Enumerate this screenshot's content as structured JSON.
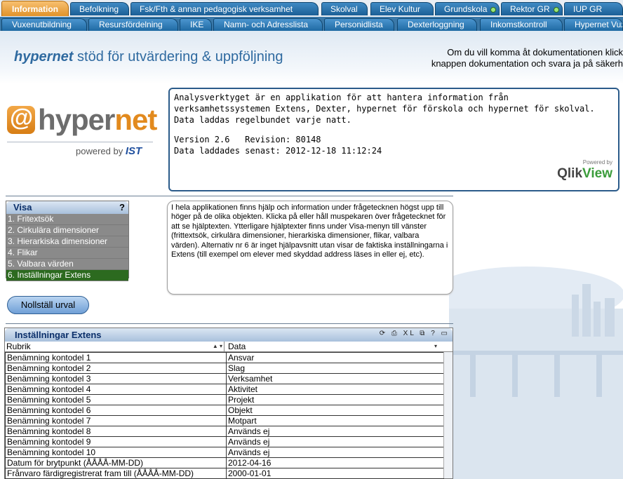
{
  "tabs_row1": [
    {
      "label": "Information",
      "active": true
    },
    {
      "label": "Befolkning"
    },
    {
      "label": "Fsk/Fth & annan pedagogisk verksamhet"
    },
    {
      "label": "Skolval"
    },
    {
      "label": "Elev Kultur"
    },
    {
      "label": "Grundskola",
      "dot": true
    },
    {
      "label": "Rektor GR",
      "dot": true
    },
    {
      "label": "IUP GR"
    }
  ],
  "tabs_row2": [
    {
      "label": "Vuxenutbildning"
    },
    {
      "label": "Resursfördelning"
    },
    {
      "label": "IKE"
    },
    {
      "label": "Namn- och Adresslista"
    },
    {
      "label": "Personidlista"
    },
    {
      "label": "Dexterloggning"
    },
    {
      "label": "Inkomstkontroll"
    },
    {
      "label": "Hypernet Vux"
    }
  ],
  "header": {
    "brand": "hypernet",
    "title_rest": " stöd för utvärdering & uppföljning",
    "note_line1": "Om du vill komma åt dokumentationen klick",
    "note_line2": "knappen dokumentation och svara ja på säkerh"
  },
  "logo": {
    "word_a": "hyper",
    "word_b": "net",
    "tag": "powered by ",
    "tag_brand": "IST"
  },
  "info": {
    "text": "Analysverktyget är en applikation för att hantera information från verksamhetssystemen Extens, Dexter, hypernet för förskola och hypernet för skolval. Data laddas regelbundet varje natt.",
    "version": "Version 2.6   Revision: 80148",
    "loaded": "Data laddades senast: 2012-12-18 11:12:24",
    "powered": "Powered by",
    "qlik_a": "Qlik",
    "qlik_b": "View"
  },
  "visa": {
    "title": "Visa",
    "help": "?",
    "items": [
      {
        "label": "1. Fritextsök"
      },
      {
        "label": "2. Cirkulära dimensioner"
      },
      {
        "label": "3. Hierarkiska dimensioner"
      },
      {
        "label": "4. Flikar"
      },
      {
        "label": "5. Valbara värden"
      },
      {
        "label": "6. Inställningar Extens",
        "selected": true
      }
    ]
  },
  "help_text": "I hela applikationen finns hjälp och information under frågetecknen högst upp till höger på de olika objekten. Klicka på eller håll muspekaren över frågetecknet för att se hjälptexten. Ytterligare hjälptexter finns under Visa-menyn till vänster (frittextsök, cirkulära dimensioner, hierarkiska dimensioner, flikar, valbara värden). Alternativ nr 6 är inget hjälpavsnitt utan visar de faktiska inställningarna i Extens (till exempel om elever med skyddad address läses in eller ej, etc).",
  "reset_button": "Nollställ urval",
  "panel": {
    "title": "Inställningar Extens",
    "icons": "⟳ ⎙ XL ⧉ ? ▭",
    "col1": "Rubrik",
    "col2": "Data",
    "rows": [
      [
        "Benämning kontodel 1",
        "Ansvar"
      ],
      [
        "Benämning kontodel 2",
        "Slag"
      ],
      [
        "Benämning kontodel 3",
        "Verksamhet"
      ],
      [
        "Benämning kontodel 4",
        "Aktivitet"
      ],
      [
        "Benämning kontodel 5",
        "Projekt"
      ],
      [
        "Benämning kontodel 6",
        "Objekt"
      ],
      [
        "Benämning kontodel 7",
        "Motpart"
      ],
      [
        "Benämning kontodel 8",
        "Används ej"
      ],
      [
        "Benämning kontodel 9",
        "Används ej"
      ],
      [
        "Benämning kontodel 10",
        "Används ej"
      ],
      [
        "Datum för brytpunkt (ÅÅÅÅ-MM-DD)",
        "2012-04-16"
      ],
      [
        "Frånvaro färdigregistrerat fram till (ÅÅÅÅ-MM-DD)",
        "2000-01-01"
      ]
    ]
  }
}
